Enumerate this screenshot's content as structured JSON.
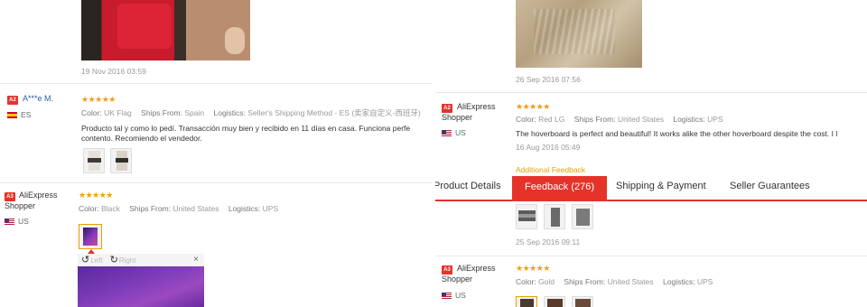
{
  "left": {
    "review1": {
      "date": "19 Nov 2016 03:59"
    },
    "review2": {
      "badge": "A2",
      "name": "A***e M.",
      "country": "ES",
      "stars": "★★★★★",
      "color_label": "Color:",
      "color_value": "UK Flag",
      "ships_label": "Ships From:",
      "ships_value": "Spain",
      "logistics_label": "Logistics:",
      "logistics_value": "Seller's Shipping Method - ES (卖家自定义-西班牙)",
      "text_line1": "Producto tal y como lo pedí. Transacción muy bien y recibido en 11 días en casa. Funciona perfe",
      "text_line2": "contento. Recomiendo el vendedor."
    },
    "review3": {
      "badge": "A3",
      "name_line1": "AliExpress",
      "name_line2": "Shopper",
      "country": "US",
      "stars": "★★★★★",
      "color_label": "Color:",
      "color_value": "Black",
      "ships_label": "Ships From:",
      "ships_value": "United States",
      "logistics_label": "Logistics:",
      "logistics_value": "UPS"
    },
    "viewer": {
      "rotate_left": "Left",
      "rotate_right": "Right",
      "close": "×"
    }
  },
  "right": {
    "review1": {
      "date": "26 Sep 2016 07:56"
    },
    "review2": {
      "badge": "A2",
      "name_line1": "AliExpress",
      "name_line2": "Shopper",
      "country": "US",
      "stars": "★★★★★",
      "color_label": "Color:",
      "color_value": "Red LG",
      "ships_label": "Ships From:",
      "ships_value": "United States",
      "logistics_label": "Logistics:",
      "logistics_value": "UPS",
      "text": "The hoverboard is perfect and beautiful! It works alike the other hoverboard despite the cost. I l",
      "date": "16 Aug 2016 05:49",
      "additional_feedback": "Additional Feedback",
      "date2": "25 Sep 2016 09:11"
    },
    "tabs": {
      "product_details": "Product Details",
      "feedback": "Feedback (276)",
      "shipping": "Shipping & Payment",
      "seller": "Seller Guarantees"
    },
    "review3": {
      "badge": "A3",
      "name_line1": "AliExpress",
      "name_line2": "Shopper",
      "country": "US",
      "stars": "★★★★★",
      "color_label": "Color:",
      "color_value": "Gold",
      "ships_label": "Ships From:",
      "ships_value": "United States",
      "logistics_label": "Logistics:",
      "logistics_value": "UPS"
    }
  }
}
